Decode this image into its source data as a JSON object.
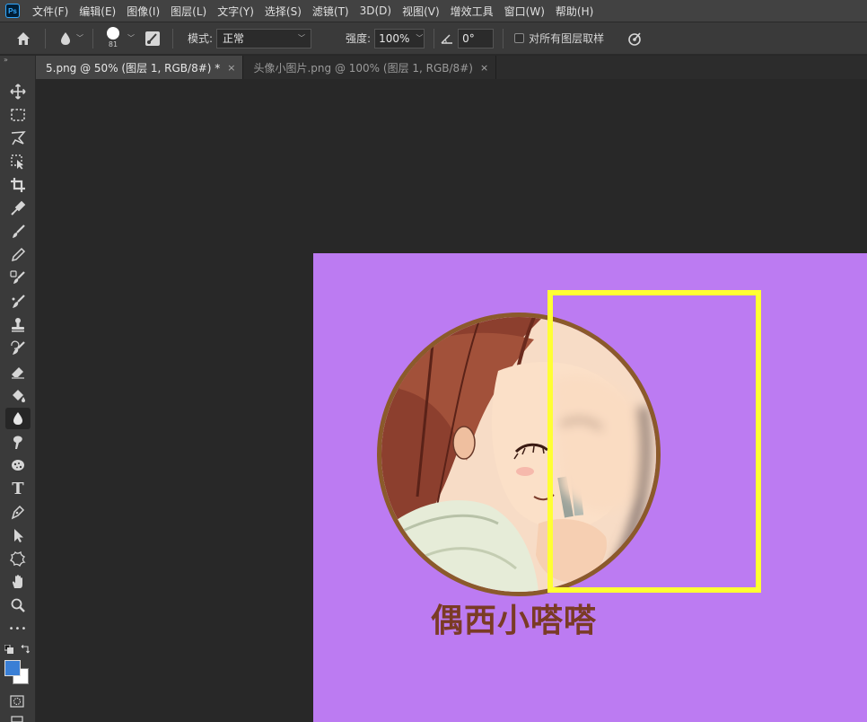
{
  "menu": {
    "app_logo": "Ps",
    "items": [
      {
        "label": "文件(F)"
      },
      {
        "label": "编辑(E)"
      },
      {
        "label": "图像(I)"
      },
      {
        "label": "图层(L)"
      },
      {
        "label": "文字(Y)"
      },
      {
        "label": "选择(S)"
      },
      {
        "label": "滤镜(T)"
      },
      {
        "label": "3D(D)"
      },
      {
        "label": "视图(V)"
      },
      {
        "label": "增效工具"
      },
      {
        "label": "窗口(W)"
      },
      {
        "label": "帮助(H)"
      }
    ]
  },
  "options": {
    "brush_size": "81",
    "mode_label": "模式:",
    "mode_value": "正常",
    "strength_label": "强度:",
    "strength_value": "100%",
    "angle_value": "0°",
    "sample_all_label": "对所有图层取样",
    "sample_all_checked": false
  },
  "tabs": [
    {
      "label": "5.png @ 50% (图层 1, RGB/8#) *",
      "active": true,
      "close": "×"
    },
    {
      "label": "头像小图片.png @ 100% (图层 1, RGB/8#)",
      "active": false,
      "close": "×"
    }
  ],
  "tools": [
    {
      "name": "move-tool-icon"
    },
    {
      "name": "marquee-tool-icon"
    },
    {
      "name": "lasso-tool-icon"
    },
    {
      "name": "object-select-tool-icon"
    },
    {
      "name": "crop-tool-icon"
    },
    {
      "name": "eyedropper-tool-icon"
    },
    {
      "name": "brush-tool-icon"
    },
    {
      "name": "pencil-tool-icon"
    },
    {
      "name": "healing-brush-tool-icon"
    },
    {
      "name": "mixer-brush-tool-icon"
    },
    {
      "name": "clone-stamp-tool-icon"
    },
    {
      "name": "history-brush-tool-icon"
    },
    {
      "name": "eraser-tool-icon"
    },
    {
      "name": "paint-bucket-tool-icon"
    },
    {
      "name": "blur-tool-icon",
      "active": true
    },
    {
      "name": "smudge-tool-icon"
    },
    {
      "name": "sponge-tool-icon"
    },
    {
      "name": "type-tool-icon",
      "glyph": "T"
    },
    {
      "name": "pen-tool-icon"
    },
    {
      "name": "path-select-tool-icon"
    },
    {
      "name": "custom-shape-tool-icon"
    },
    {
      "name": "hand-tool-icon"
    },
    {
      "name": "zoom-tool-icon"
    },
    {
      "name": "more-tools-icon",
      "glyph": "•••"
    }
  ],
  "colors": {
    "foreground": "#3a7fd5",
    "background": "#ffffff",
    "canvas": "#bc7bf2",
    "selection": "#ffff33",
    "caption": "#7a3b25"
  },
  "document": {
    "caption": "偶西小嗒嗒",
    "image_name": "anime-girl-avatar"
  }
}
